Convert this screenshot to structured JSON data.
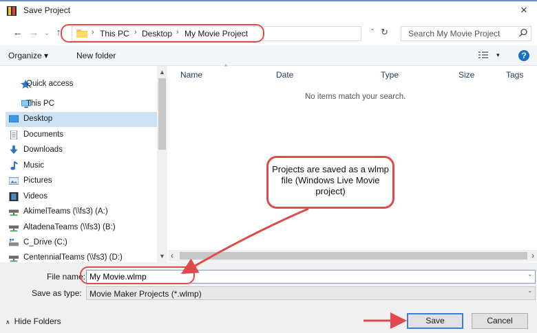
{
  "window": {
    "title": "Save Project",
    "close_glyph": "×"
  },
  "navigation": {
    "back_glyph": "←",
    "forward_glyph": "→",
    "recent_glyph": "⌄",
    "up_glyph": "↑",
    "breadcrumb": [
      "This PC",
      "Desktop",
      "My Movie Project"
    ],
    "separator": "›",
    "dropdown_glyph": "⌄",
    "refresh_glyph": "↻"
  },
  "search": {
    "placeholder": "Search My Movie Project"
  },
  "toolbar": {
    "organize_label": "Organize ▾",
    "new_folder_label": "New folder",
    "view_dropdown_glyph": "▾",
    "help_glyph": "?"
  },
  "sidebar": {
    "items": [
      {
        "label": "Quick access",
        "icon": "star-icon"
      },
      {
        "label": "This PC",
        "icon": "computer-icon"
      },
      {
        "label": "Desktop",
        "icon": "desktop-icon",
        "selected": true
      },
      {
        "label": "Documents",
        "icon": "documents-icon"
      },
      {
        "label": "Downloads",
        "icon": "downloads-icon"
      },
      {
        "label": "Music",
        "icon": "music-icon"
      },
      {
        "label": "Pictures",
        "icon": "pictures-icon"
      },
      {
        "label": "Videos",
        "icon": "videos-icon"
      },
      {
        "label": "AkimelTeams (\\\\fs3) (A:)",
        "icon": "network-drive-icon"
      },
      {
        "label": "AltadenaTeams (\\\\fs3) (B:)",
        "icon": "network-drive-icon"
      },
      {
        "label": "C_Drive (C:)",
        "icon": "drive-icon"
      },
      {
        "label": "CentennialTeams (\\\\fs3) (D:)",
        "icon": "network-drive-icon"
      }
    ],
    "scroll_up_glyph": "▲",
    "scroll_down_glyph": "▼"
  },
  "file_list": {
    "columns": [
      "Name",
      "Date",
      "Type",
      "Size",
      "Tags"
    ],
    "sort_glyph": "^",
    "empty_message": "No items match your search.",
    "scroll_left_glyph": "‹",
    "scroll_right_glyph": "›"
  },
  "fields": {
    "file_name_label": "File name:",
    "file_name_value": "My Movie.wlmp",
    "save_as_type_label": "Save as type:",
    "save_as_type_value": "Movie Maker Projects (*.wlmp)",
    "dropdown_glyph": "⌄"
  },
  "footer": {
    "hide_folders_glyph": "∧",
    "hide_folders_label": "Hide Folders",
    "save_label": "Save",
    "cancel_label": "Cancel"
  },
  "annotation": {
    "callout_text": "Projects are saved as a wlmp file (Windows Live Movie project)"
  },
  "colors": {
    "highlight": "#e04a4a",
    "selection": "#cce1f5",
    "accent": "#1572c4"
  }
}
